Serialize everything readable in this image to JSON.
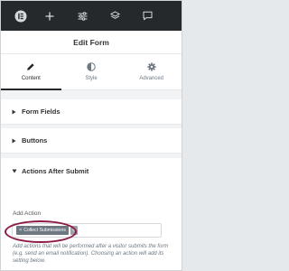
{
  "toolbar": {
    "icons": [
      "elementor-logo-icon",
      "add-element-icon",
      "site-settings-sliders-icon",
      "structure-layers-icon",
      "comments-icon"
    ]
  },
  "header": {
    "title": "Edit Form"
  },
  "tabs": [
    {
      "label": "Content",
      "icon": "pencil-icon",
      "active": true
    },
    {
      "label": "Style",
      "icon": "half-circle-icon",
      "active": false
    },
    {
      "label": "Advanced",
      "icon": "gear-icon",
      "active": false
    }
  ],
  "sections": [
    {
      "label": "Form Fields",
      "expanded": false
    },
    {
      "label": "Buttons",
      "expanded": false
    },
    {
      "label": "Actions After Submit",
      "expanded": true
    }
  ],
  "actions": {
    "add_action_label": "Add Action",
    "selected_chip": "Collect Submissions",
    "chip_remove": "×",
    "add_symbol": "+",
    "help_text": "Add actions that will be performed after a visitor submits the form (e.g. send an email notification). Choosing an action will add its setting below."
  },
  "colors": {
    "toolbar_bg": "#26292c",
    "chip_bg": "#6d7882",
    "highlight": "#8d1a45"
  }
}
